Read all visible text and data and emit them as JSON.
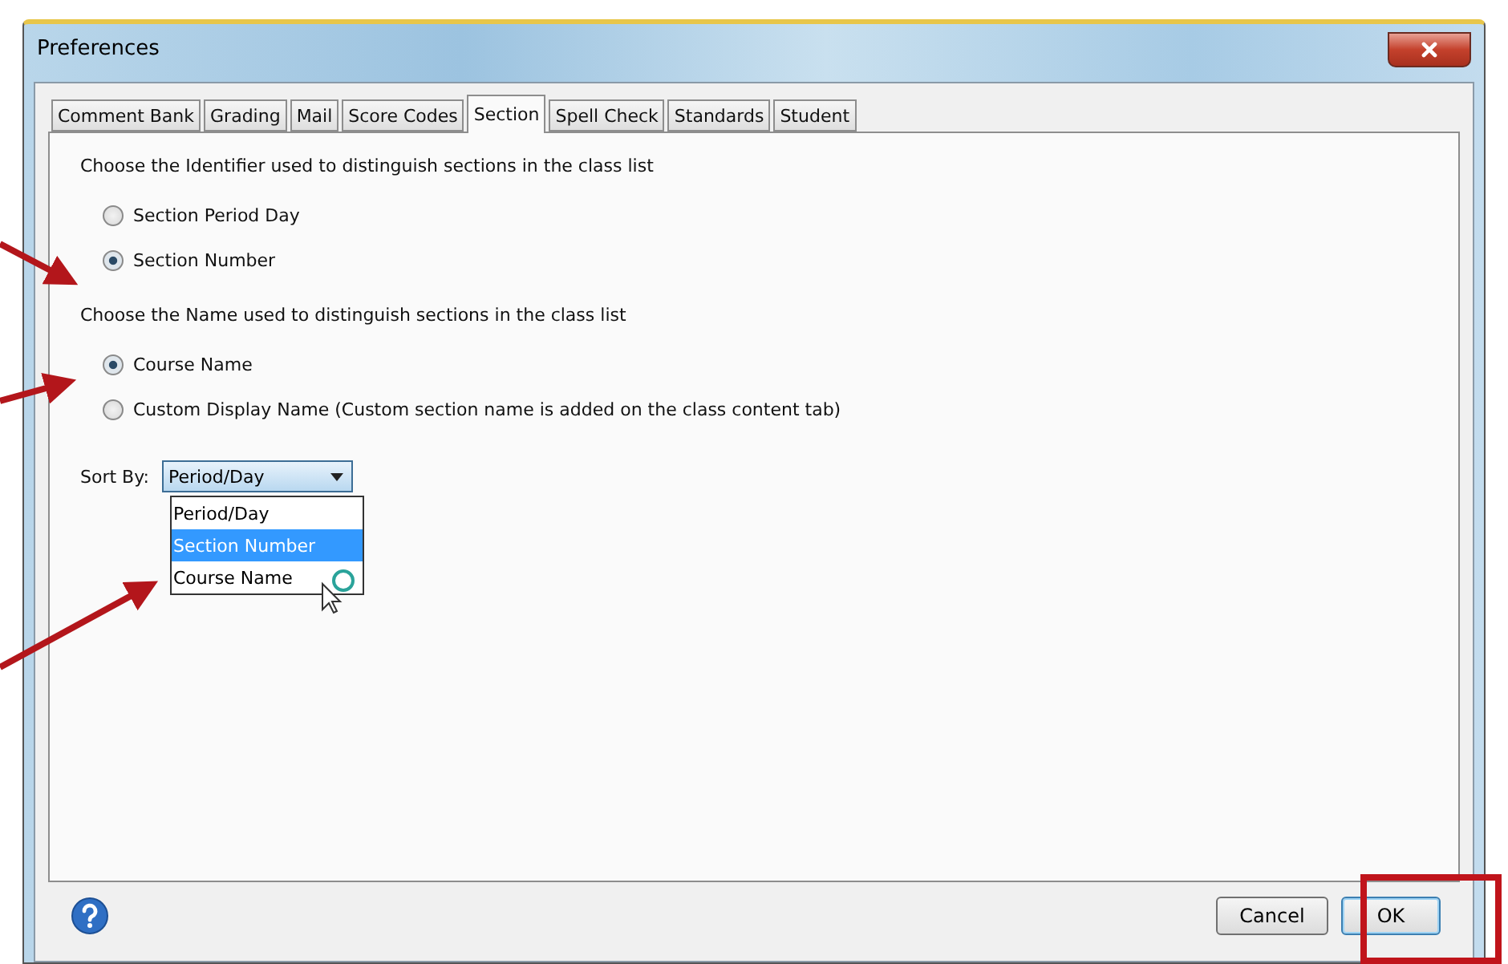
{
  "window": {
    "title": "Preferences"
  },
  "tabs": [
    {
      "label": "Comment Bank",
      "selected": false
    },
    {
      "label": "Grading",
      "selected": false
    },
    {
      "label": "Mail",
      "selected": false
    },
    {
      "label": "Score Codes",
      "selected": false
    },
    {
      "label": "Section",
      "selected": true
    },
    {
      "label": "Spell Check",
      "selected": false
    },
    {
      "label": "Standards",
      "selected": false
    },
    {
      "label": "Student",
      "selected": false
    }
  ],
  "groups": [
    {
      "heading": "Choose the Identifier used to distinguish sections in the class list",
      "options": [
        {
          "label": "Section Period Day",
          "selected": false
        },
        {
          "label": "Section Number",
          "selected": true
        }
      ]
    },
    {
      "heading": "Choose the Name used to distinguish sections in the class list",
      "options": [
        {
          "label": "Course Name",
          "selected": true
        },
        {
          "label": "Custom Display Name (Custom section name is added on the class content tab)",
          "selected": false
        }
      ]
    }
  ],
  "sort": {
    "label": "Sort By:",
    "value": "Period/Day",
    "expanded": true,
    "options": [
      {
        "label": "Period/Day",
        "highlighted": false
      },
      {
        "label": "Section Number",
        "highlighted": true
      },
      {
        "label": "Course Name",
        "highlighted": false
      }
    ]
  },
  "buttons": [
    {
      "label": "Cancel",
      "default": false
    },
    {
      "label": "OK",
      "default": true
    }
  ]
}
